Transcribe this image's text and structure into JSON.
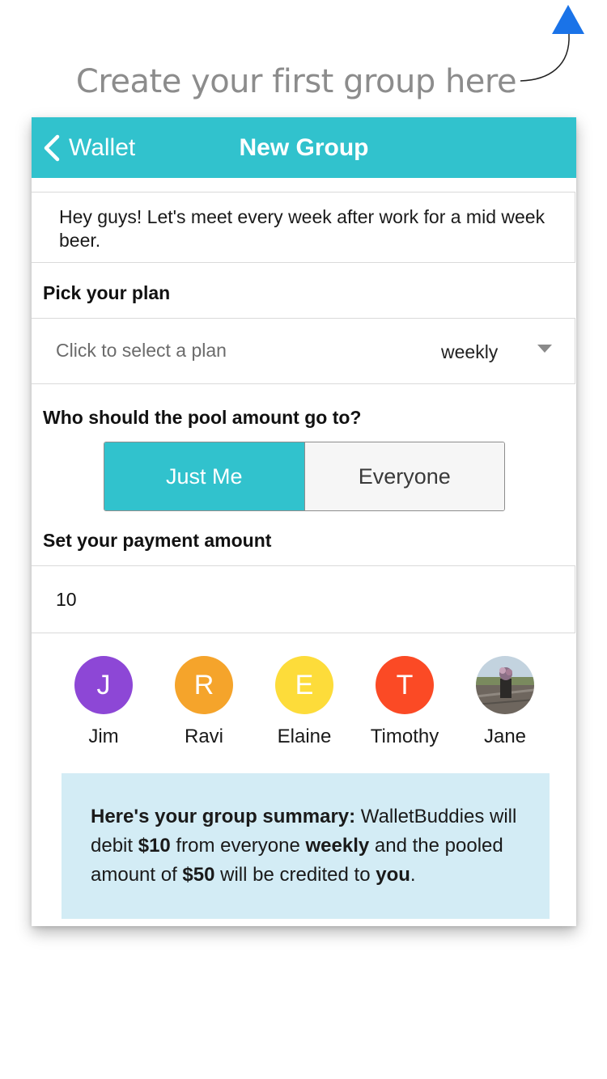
{
  "hint": {
    "text": "Create your first group here"
  },
  "navbar": {
    "back_label": "Wallet",
    "title": "New Group"
  },
  "group": {
    "message": "Hey guys! Let's meet every week after work for a mid week beer."
  },
  "plan": {
    "label": "Pick your plan",
    "placeholder": "Click to select a plan",
    "value": "weekly"
  },
  "pool": {
    "label": "Who should the pool amount go to?",
    "options": [
      {
        "label": "Just Me",
        "selected": true
      },
      {
        "label": "Everyone",
        "selected": false
      }
    ]
  },
  "payment": {
    "label": "Set your payment amount",
    "value": "10"
  },
  "members": [
    {
      "initial": "J",
      "name": "Jim",
      "color": "#8d47d6"
    },
    {
      "initial": "R",
      "name": "Ravi",
      "color": "#f5a42b"
    },
    {
      "initial": "E",
      "name": "Elaine",
      "color": "#fddc3a"
    },
    {
      "initial": "T",
      "name": "Timothy",
      "color": "#fb4a25"
    },
    {
      "initial": "",
      "name": "Jane",
      "color": "#6d7b87",
      "photo": true
    }
  ],
  "summary": {
    "heading": "Here's your group summary:",
    "t1": " WalletBuddies will debit ",
    "amount": "$10",
    "t2": " from everyone ",
    "frequency": "weekly",
    "t3": " and the pooled amount of ",
    "pool_total": "$50",
    "t4": " will be credited to ",
    "recipient": "you",
    "t5": "."
  },
  "colors": {
    "accent": "#31c2cd",
    "summary_bg": "#d3ecf5",
    "hint_arrow": "#1a73e8"
  }
}
